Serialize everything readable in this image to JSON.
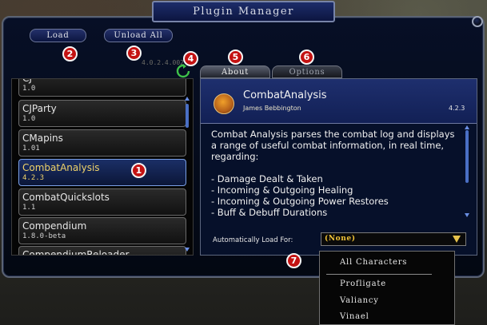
{
  "window": {
    "title": "Plugin Manager",
    "buttons": {
      "load": "Load",
      "unload_all": "Unload All"
    }
  },
  "list": {
    "faint_version": "4.0.2.4.002",
    "items": [
      {
        "name": "CJ",
        "version": "1.0"
      },
      {
        "name": "CJParty",
        "version": "1.0"
      },
      {
        "name": "CMapins",
        "version": "1.01"
      },
      {
        "name": "CombatAnalysis",
        "version": "4.2.3",
        "selected": true
      },
      {
        "name": "CombatQuickslots",
        "version": "1.1"
      },
      {
        "name": "Compendium",
        "version": "1.8.0-beta"
      },
      {
        "name": "CompendiumReloader",
        "version": ""
      }
    ]
  },
  "tabs": {
    "about": "About",
    "options": "Options"
  },
  "detail": {
    "name": "CombatAnalysis",
    "author": "James Bebbington",
    "version": "4.2.3",
    "description": "Combat Analysis parses the combat log and displays a range of useful combat information, in real time, regarding:",
    "bullets": [
      "- Damage Dealt & Taken",
      "- Incoming & Outgoing Healing",
      "- Incoming & Outgoing Power Restores",
      "- Buff & Debuff Durations"
    ],
    "autoload_label": "Automatically Load For:",
    "autoload_value": "(None)"
  },
  "dropdown": {
    "options": [
      "All Characters",
      "Profligate",
      "Valiancy",
      "Vinael"
    ]
  },
  "markers": [
    "1",
    "2",
    "3",
    "4",
    "5",
    "6",
    "7"
  ],
  "colors": {
    "window_bg": "#070f26",
    "title_plate": "#1d2d6a",
    "selected_text": "#f0d36a",
    "dropdown_value": "#f2c437",
    "marker": "#c41212"
  },
  "icons": {
    "refresh": "refresh-icon",
    "close": "close-icon",
    "plugin": "combat-analysis-icon",
    "dropdown": "chevron-down-icon"
  }
}
